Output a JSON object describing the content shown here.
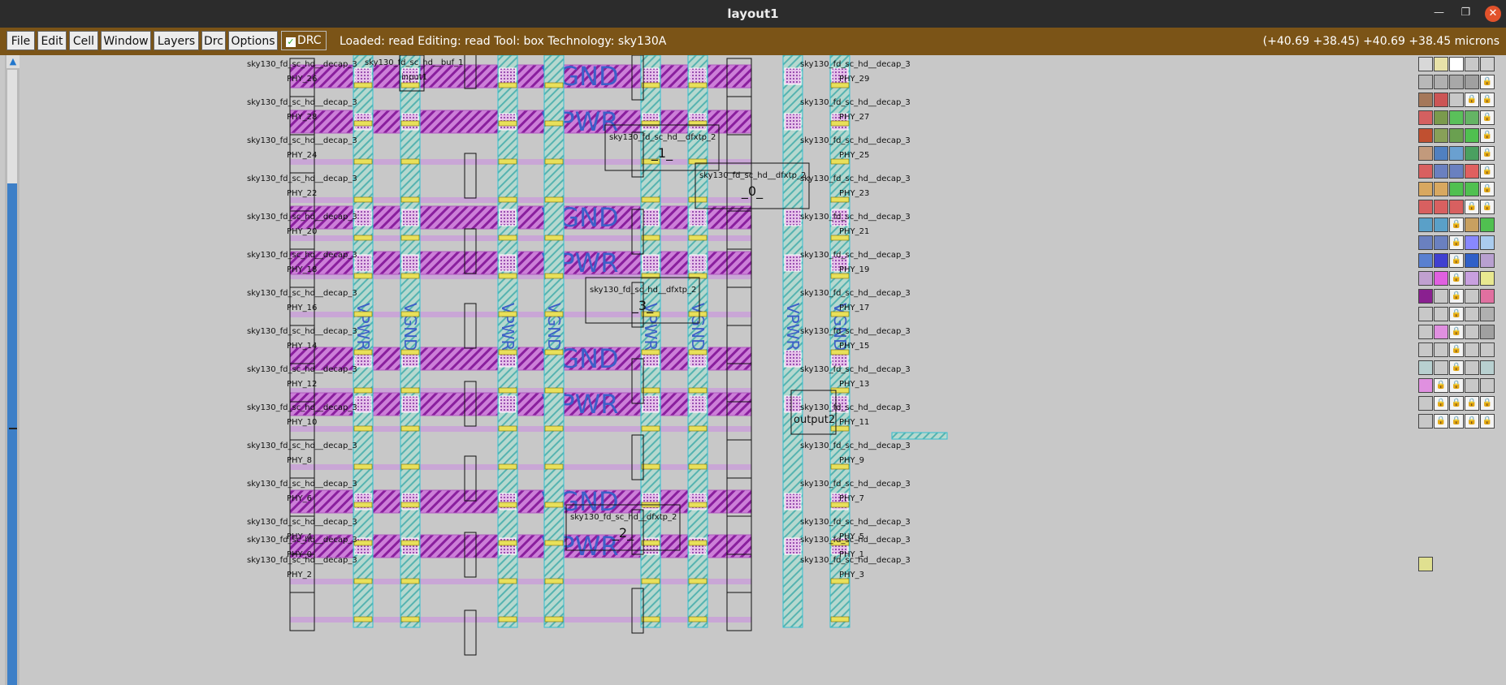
{
  "window": {
    "title": "layout1"
  },
  "menu": [
    "File",
    "Edit",
    "Cell",
    "Window",
    "Layers",
    "Drc",
    "Options"
  ],
  "drc_label": "DRC",
  "status": "Loaded: read  Editing: read  Tool: box   Technology: sky130A",
  "coords": "(+40.69 +38.45) +40.69 +38.45 microns",
  "layout": {
    "rails": [
      "VGND",
      "VPWR",
      "VGND",
      "VPWR",
      "VGND",
      "VPWR",
      "VGND",
      "VPWR"
    ],
    "vstrips": [
      "VPWR",
      "VGND",
      "VPWR",
      "VGND",
      "VPWR",
      "VGND",
      "VPWR",
      "VGND"
    ],
    "decap_cell": "sky130_fd_sc_hd__decap_3",
    "left_phy": [
      "PHY_26",
      "PHY_28",
      "PHY_24",
      "PHY_22",
      "PHY_20",
      "PHY_18",
      "PHY_16",
      "PHY_14",
      "PHY_12",
      "PHY_10",
      "PHY_8",
      "PHY_6",
      "PHY_4",
      "PHY_2",
      "PHY_0"
    ],
    "right_phy": [
      "PHY_29",
      "PHY_27",
      "PHY_25",
      "PHY_23",
      "PHY_21",
      "PHY_19",
      "PHY_17",
      "PHY_15",
      "PHY_13",
      "PHY_11",
      "PHY_9",
      "PHY_7",
      "PHY_5",
      "PHY_3",
      "PHY_1"
    ],
    "buf_cell": "sky130_fd_sc_hd__buf_1",
    "buf_inst": "input1",
    "output_inst": "output2",
    "dff": [
      {
        "cell": "sky130_fd_sc_hd__dfxtp_2",
        "inst": "_1_"
      },
      {
        "cell": "sky130_fd_sc_hd__dfxtp_2",
        "inst": "_0_"
      },
      {
        "cell": "sky130_fd_sc_hd__dfxtp_2",
        "inst": "_3_"
      },
      {
        "cell": "sky130_fd_sc_hd__dfxtp_2",
        "inst": "_2_"
      }
    ]
  },
  "icons": {
    "close": "close-icon",
    "minimize": "minimize-icon",
    "maximize": "maximize-icon",
    "scroll_up": "scroll-up-arrow-icon",
    "check": "check-icon",
    "lock": "lock-icon"
  }
}
